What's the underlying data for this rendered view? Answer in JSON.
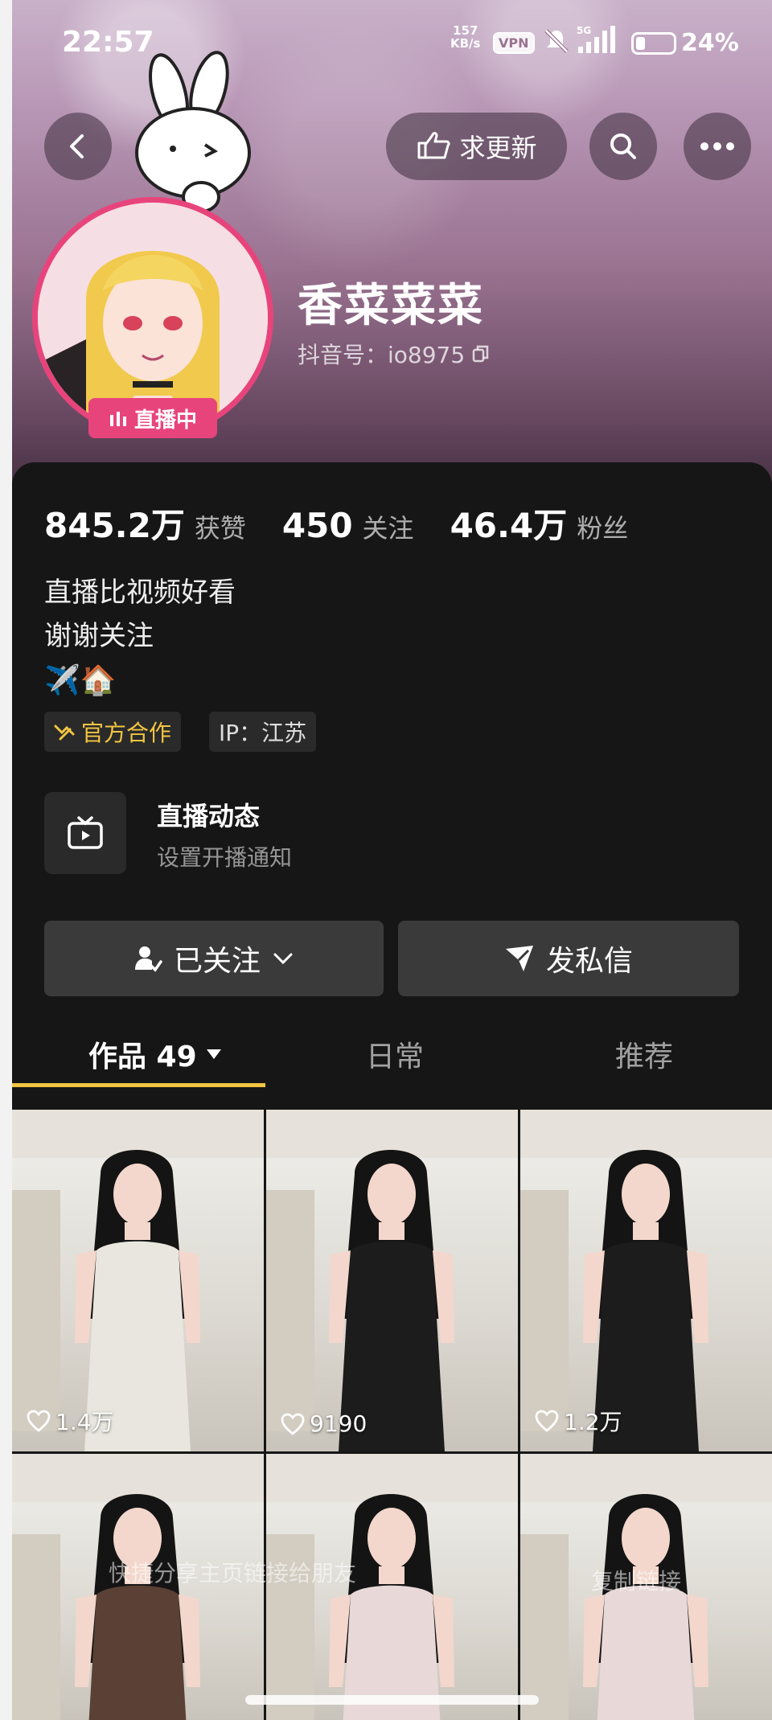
{
  "status_bar": {
    "time": "22:57",
    "net_speed_value": "157",
    "net_speed_unit": "KB/s",
    "vpn_label": "VPN",
    "network_label": "5G",
    "battery_percent": "24%",
    "battery_level": 0.24
  },
  "header": {
    "request_update_label": "求更新"
  },
  "profile": {
    "nickname": "香菜菜菜",
    "douyin_id": "抖音号：io8975",
    "live_badge": "直播中"
  },
  "stats": [
    {
      "value": "845.2万",
      "label": "获赞"
    },
    {
      "value": "450",
      "label": "关注"
    },
    {
      "value": "46.4万",
      "label": "粉丝"
    }
  ],
  "bio": {
    "line1": "直播比视频好看",
    "line2": "谢谢关注",
    "emoji": "✈️🏠"
  },
  "tags": {
    "official": "官方合作",
    "ip": "IP：江苏"
  },
  "live_feed": {
    "title": "直播动态",
    "subtitle": "设置开播通知"
  },
  "actions": {
    "follow": "已关注",
    "message": "发私信"
  },
  "tabs": {
    "works": "作品 49",
    "daily": "日常",
    "recommend": "推荐"
  },
  "videos": [
    {
      "likes": "1.4万",
      "dress": "#e9e6df"
    },
    {
      "likes": "9190",
      "dress": "#1c1c1c"
    },
    {
      "likes": "1.2万",
      "dress": "#1c1c1c"
    },
    {
      "likes": "",
      "dress": "#5a4035"
    },
    {
      "likes": "",
      "dress": "#e8d8d8"
    },
    {
      "likes": "",
      "dress": "#e8d8d8"
    }
  ],
  "overlays": {
    "share": "快捷分享主页链接给朋友",
    "copy": "复制链接"
  },
  "colors": {
    "live_pink": "#e8447c",
    "official_gold": "#f2c542",
    "card_bg": "#161616"
  }
}
